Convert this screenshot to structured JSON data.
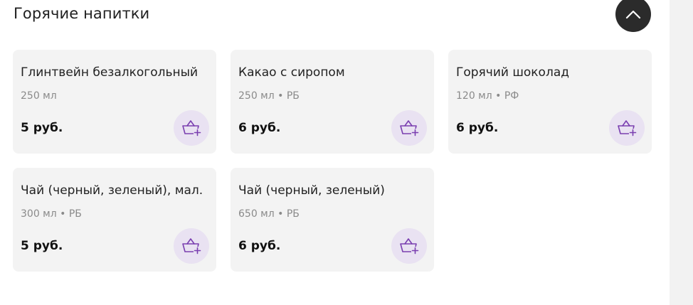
{
  "section": {
    "title": "Горячие напитки"
  },
  "colors": {
    "card_background": "#f3f3f3",
    "cart_button_background": "#e9e2f2",
    "cart_icon": "#7a3fb0",
    "collapse_button_background": "#2b2b2b"
  },
  "icons": {
    "collapse": "chevron-up-icon",
    "add_to_cart": "basket-plus-icon"
  },
  "products": [
    {
      "name": "Глинтвейн безалкогольный",
      "meta": "250 мл",
      "price": "5 руб."
    },
    {
      "name": "Какао с сиропом",
      "meta": "250 мл • РБ",
      "price": "6 руб."
    },
    {
      "name": "Горячий шоколад",
      "meta": "120 мл • РФ",
      "price": "6 руб."
    },
    {
      "name": "Чай (черный, зеленый), мал.",
      "meta": "300 мл • РБ",
      "price": "5 руб."
    },
    {
      "name": "Чай (черный, зеленый)",
      "meta": "650 мл • РБ",
      "price": "6 руб."
    }
  ]
}
